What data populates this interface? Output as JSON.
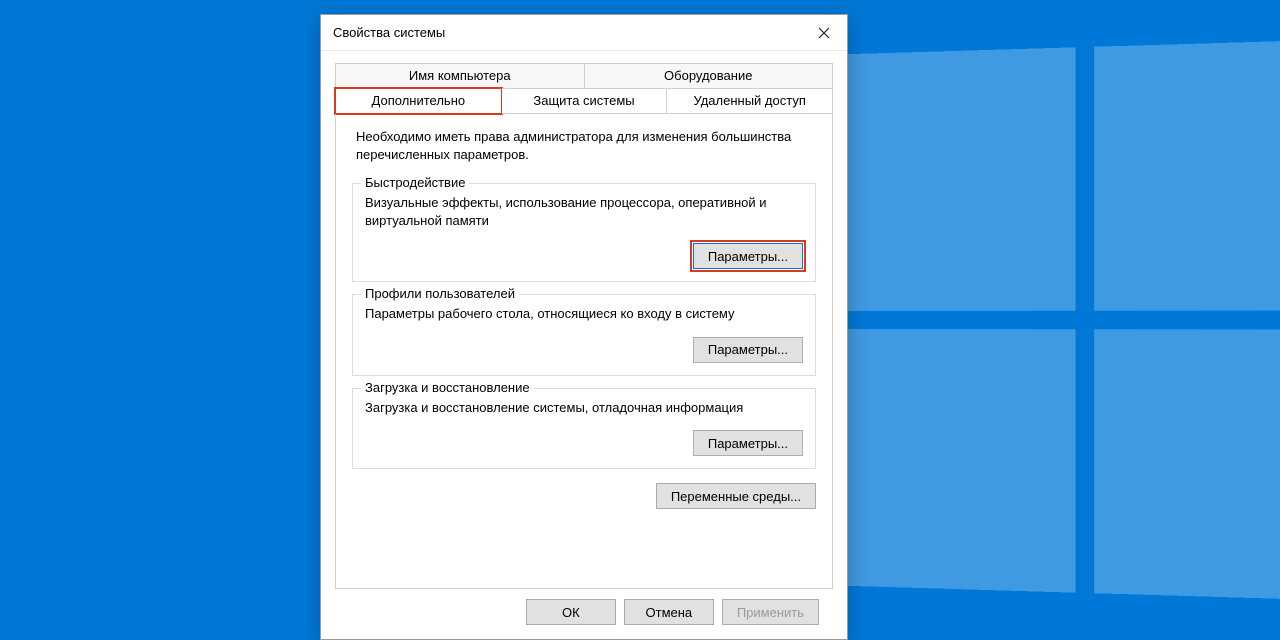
{
  "dialog": {
    "title": "Свойства системы",
    "tabs_row1": [
      "Имя компьютера",
      "Оборудование"
    ],
    "tabs_row2": [
      "Дополнительно",
      "Защита системы",
      "Удаленный доступ"
    ],
    "active_tab": "Дополнительно",
    "intro": "Необходимо иметь права администратора для изменения большинства перечисленных параметров.",
    "groups": {
      "performance": {
        "legend": "Быстродействие",
        "desc": "Визуальные эффекты, использование процессора, оперативной и виртуальной памяти",
        "button": "Параметры..."
      },
      "profiles": {
        "legend": "Профили пользователей",
        "desc": "Параметры рабочего стола, относящиеся ко входу в систему",
        "button": "Параметры..."
      },
      "startup": {
        "legend": "Загрузка и восстановление",
        "desc": "Загрузка и восстановление системы, отладочная информация",
        "button": "Параметры..."
      }
    },
    "env_button": "Переменные среды...",
    "footer": {
      "ok": "ОК",
      "cancel": "Отмена",
      "apply": "Применить"
    }
  }
}
